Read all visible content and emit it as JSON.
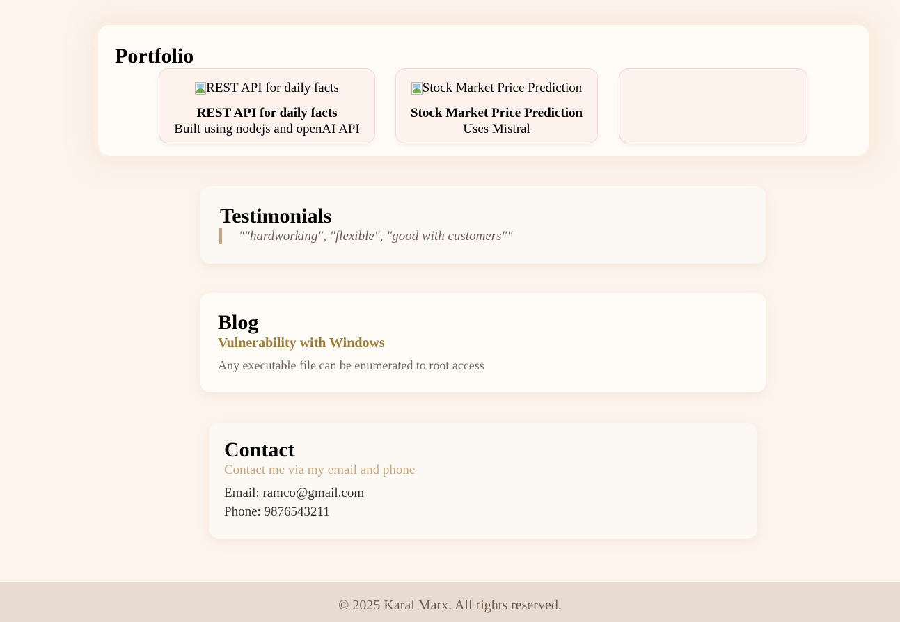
{
  "portfolio": {
    "heading": "Portfolio",
    "projects": [
      {
        "image_alt": "REST API for daily facts",
        "title": "REST API for daily facts",
        "description": "Built using nodejs and openAI API"
      },
      {
        "image_alt": "Stock Market Price Prediction",
        "title": "Stock Market Price Prediction",
        "description": "Uses Mistral"
      }
    ]
  },
  "testimonials": {
    "heading": "Testimonials",
    "quote": "\"\"hardworking\", \"flexible\", \"good with customers\"\""
  },
  "blog": {
    "heading": "Blog",
    "post_title": "Vulnerability with Windows",
    "post_body": "Any executable file can be enumerated to root access"
  },
  "contact": {
    "heading": "Contact",
    "subtitle": "Contact me via my email and phone",
    "email": "Email: ramco@gmail.com",
    "phone": "Phone: 9876543211"
  },
  "footer": {
    "text": "© 2025 Karal Marx. All rights reserved."
  }
}
